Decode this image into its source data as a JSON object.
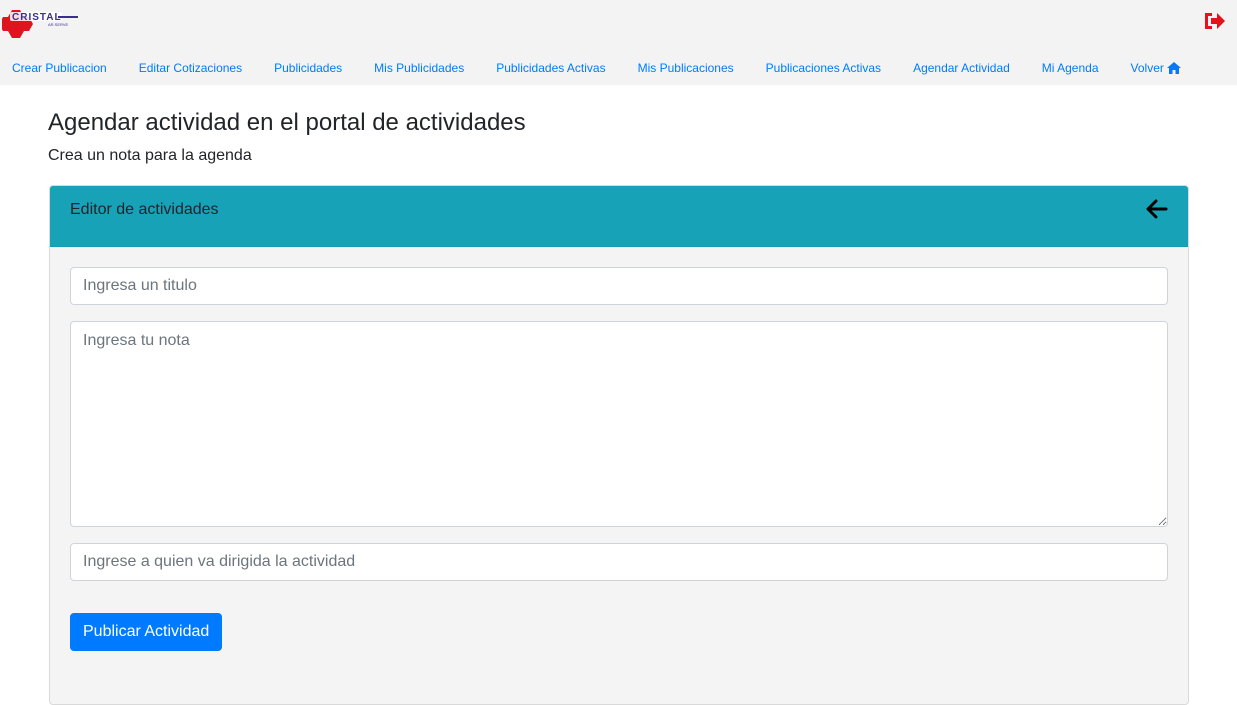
{
  "brand": {
    "logo_text": "CRISTAL",
    "logo_subtext": "AR.SERVE",
    "logo_icon": "cristal-logo",
    "logo_primary_color": "#e0141e",
    "logo_text_color": "#3a2f8f"
  },
  "header": {
    "logout_icon": "sign-out-icon",
    "logout_color": "#e3121b"
  },
  "nav": {
    "items": [
      {
        "label": "Crear Publicacion"
      },
      {
        "label": "Editar Cotizaciones"
      },
      {
        "label": "Publicidades"
      },
      {
        "label": "Mis Publicidades"
      },
      {
        "label": "Publicidades Activas"
      },
      {
        "label": "Mis Publicaciones"
      },
      {
        "label": "Publicaciones Activas"
      },
      {
        "label": "Agendar Actividad"
      },
      {
        "label": "Mi Agenda"
      },
      {
        "label": "Volver",
        "icon": "home-icon"
      }
    ],
    "link_color": "#007bff"
  },
  "page": {
    "title": "Agendar actividad en el portal de actividades",
    "subtitle": "Crea un nota para la agenda"
  },
  "card": {
    "header_title": "Editor de actividades",
    "header_color": "#17a2b8",
    "back_icon": "arrow-left-icon",
    "form": {
      "title_placeholder": "Ingresa un titulo",
      "title_value": "",
      "note_placeholder": "Ingresa tu nota",
      "note_value": "",
      "recipient_placeholder": "Ingrese a quien va dirigida la actividad",
      "recipient_value": "",
      "submit_label": "Publicar Actividad",
      "submit_color": "#007bff"
    }
  }
}
